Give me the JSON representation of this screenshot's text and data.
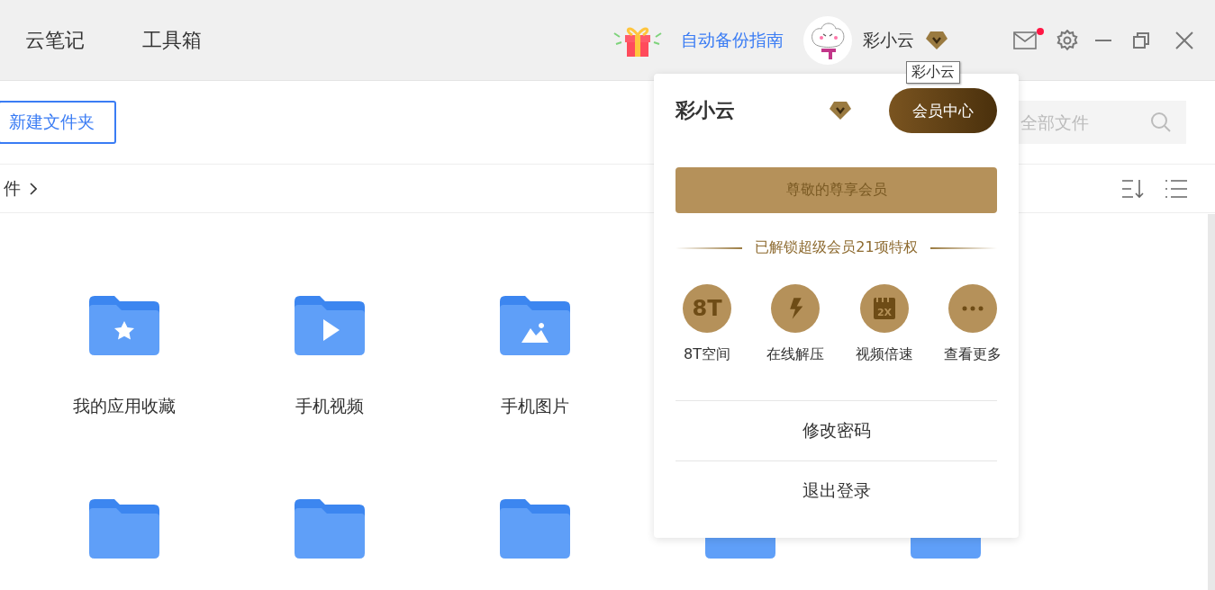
{
  "top_nav": [
    {
      "label": "云笔记"
    },
    {
      "label": "工具箱"
    }
  ],
  "backup_guide": "自动备份指南",
  "user": {
    "name": "彩小云",
    "tooltip": "彩小云"
  },
  "mail_unread": true,
  "toolbar": {
    "new_folder": "新建文件夹",
    "search_placeholder": "全部文件"
  },
  "breadcrumb": [
    "件"
  ],
  "folder_rows": [
    [
      {
        "name": "我的应用收藏",
        "kind": "star"
      },
      {
        "name": "手机视频",
        "kind": "video"
      },
      {
        "name": "手机图片",
        "kind": "image"
      }
    ],
    [
      {
        "kind": "plain"
      },
      {
        "kind": "plain"
      },
      {
        "kind": "plain"
      },
      {
        "kind": "plain"
      },
      {
        "kind": "plain"
      }
    ]
  ],
  "user_menu": {
    "name": "彩小云",
    "member_center": "会员中心",
    "member_banner": "尊敬的尊享会员",
    "privileges_title": "已解锁超级会员21项特权",
    "features": [
      {
        "kind": "space",
        "icon_text": "8T",
        "label": "8T空间"
      },
      {
        "kind": "unzip",
        "label": "在线解压"
      },
      {
        "kind": "speed",
        "icon_text": "2X",
        "label": "视频倍速"
      },
      {
        "kind": "more",
        "label": "查看更多"
      }
    ],
    "items": [
      {
        "label": "修改密码"
      },
      {
        "label": "退出登录"
      }
    ]
  }
}
